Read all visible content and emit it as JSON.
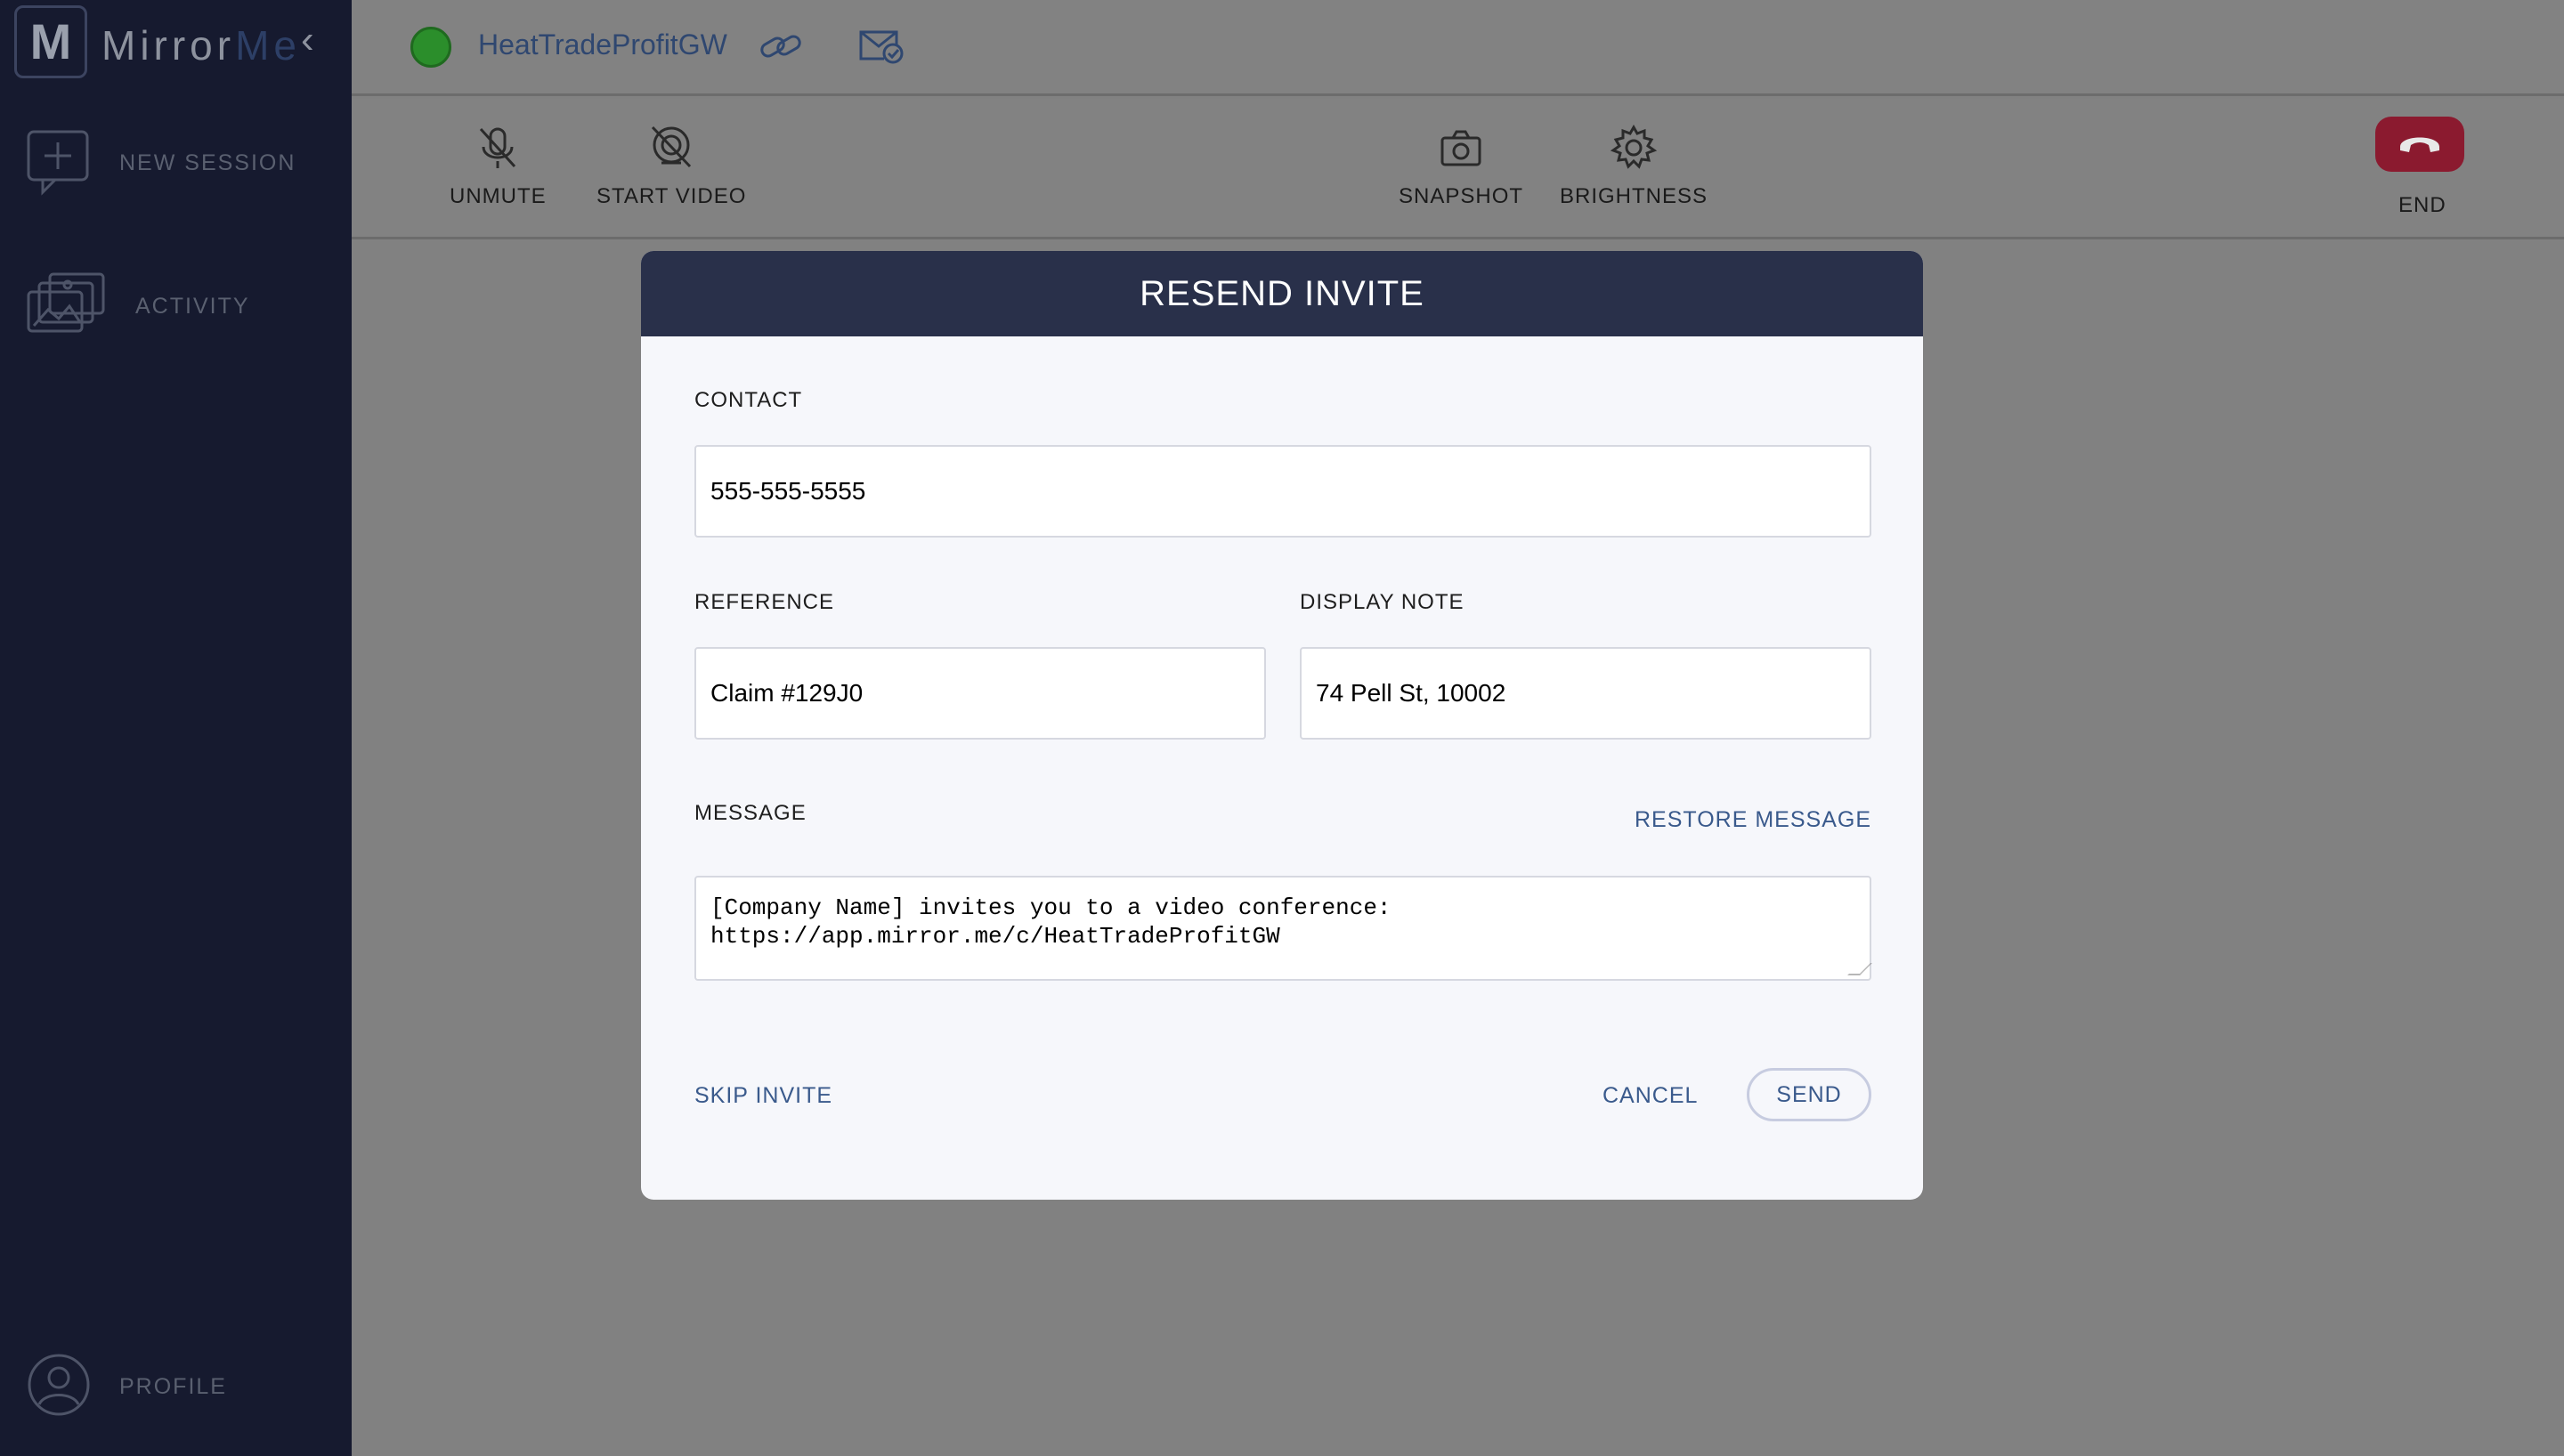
{
  "app": {
    "logo_letter": "M",
    "logo_text_a": "Mirror",
    "logo_text_b": "Me",
    "collapse_glyph": "‹"
  },
  "sidebar": {
    "items": [
      {
        "label": "NEW SESSION",
        "icon": "new-session-icon"
      },
      {
        "label": "ACTIVITY",
        "icon": "activity-icon"
      }
    ],
    "profile_label": "PROFILE"
  },
  "topbar": {
    "session_name": "HeatTradeProfitGW",
    "status_color": "#2b8e2b"
  },
  "toolbar": {
    "unmute": "UNMUTE",
    "start_video": "START VIDEO",
    "snapshot": "SNAPSHOT",
    "brightness": "BRIGHTNESS",
    "end": "END"
  },
  "modal": {
    "title": "RESEND INVITE",
    "contact_label": "CONTACT",
    "contact_value": "555-555-5555",
    "reference_label": "REFERENCE",
    "reference_value": "Claim #129J0",
    "display_note_label": "DISPLAY NOTE",
    "display_note_value": "74 Pell St, 10002",
    "message_label": "MESSAGE",
    "restore_message": "RESTORE MESSAGE",
    "message_value": "[Company Name] invites you to a video conference:\nhttps://app.mirror.me/c/HeatTradeProfitGW",
    "skip_invite": "SKIP INVITE",
    "cancel": "CANCEL",
    "send": "SEND"
  }
}
